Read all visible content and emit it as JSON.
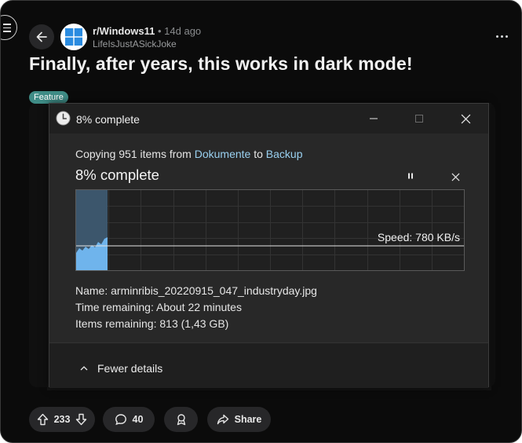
{
  "post": {
    "subreddit": "r/Windows11",
    "separator": "•",
    "age": "14d ago",
    "author": "LifeIsJustASickJoke",
    "title": "Finally, after years, this works in dark mode!",
    "flair": "Feature"
  },
  "dialog": {
    "window_title": "8% complete",
    "copying_prefix": "Copying 951 items from",
    "source": "Dokumente",
    "to": "to",
    "destination": "Backup",
    "percent_text": "8% complete",
    "progress": 0.08,
    "speed": "Speed: 780 KB/s",
    "name_label": "Name:",
    "name_value": "arminribis_20220915_047_industryday.jpg",
    "time_label": "Time remaining:",
    "time_value": "About 22 minutes",
    "items_label": "Items remaining:",
    "items_value": "813 (1,43 GB)",
    "toggle_label": "Fewer details"
  },
  "actions": {
    "upvotes": "233",
    "comments": "40",
    "share": "Share"
  },
  "colors": {
    "accent_link": "#99d0f0",
    "flair_bg": "#3f8c86",
    "progress_fill": "#3c566c",
    "speed_fill": "#6fb4ec"
  }
}
